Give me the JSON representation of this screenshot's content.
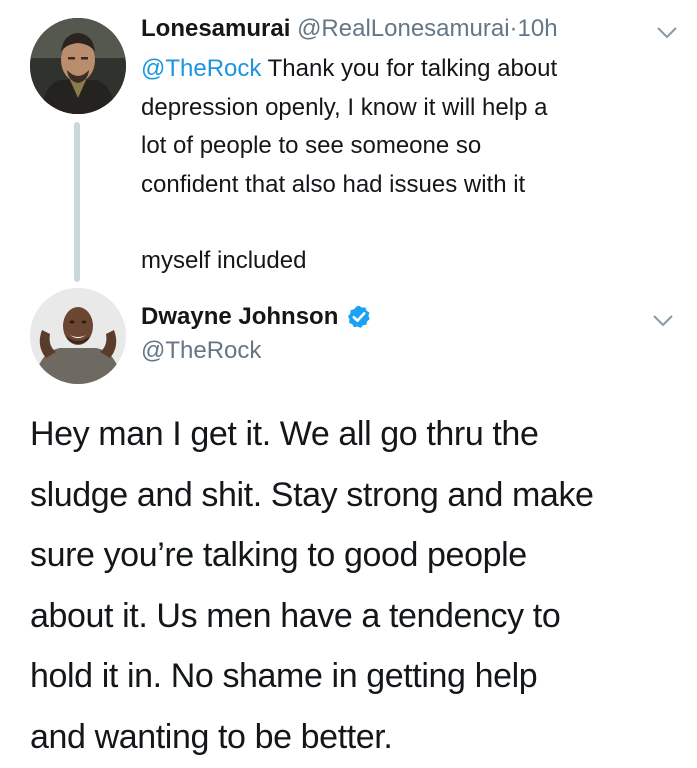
{
  "reply": {
    "author_name": "Lonesamurai",
    "author_handle": "@RealLonesamurai",
    "separator": "·",
    "time": "10h",
    "mention": "@TheRock",
    "lines": [
      "Thank you for talking about",
      "depression openly, I know it will help a",
      "lot of people to see someone so",
      "confident that also had issues with it",
      "myself included"
    ]
  },
  "tweet": {
    "author_name": "Dwayne Johnson",
    "author_handle": "@TheRock",
    "verified": true,
    "lines": [
      "Hey man I get it. We all go thru the",
      "sludge and shit. Stay strong and make",
      "sure you’re talking to good people",
      "about it. Us men have a tendency to",
      "hold it in. No shame in getting help",
      "and wanting to be better."
    ]
  },
  "colors": {
    "text": "#14171a",
    "secondary": "#657786",
    "link": "#1b95e0",
    "verified": "#1da1f2",
    "thread_line": "#ccd6dd"
  },
  "icons": {
    "menu": "chevron-down-icon",
    "verified": "verified-badge-icon"
  }
}
